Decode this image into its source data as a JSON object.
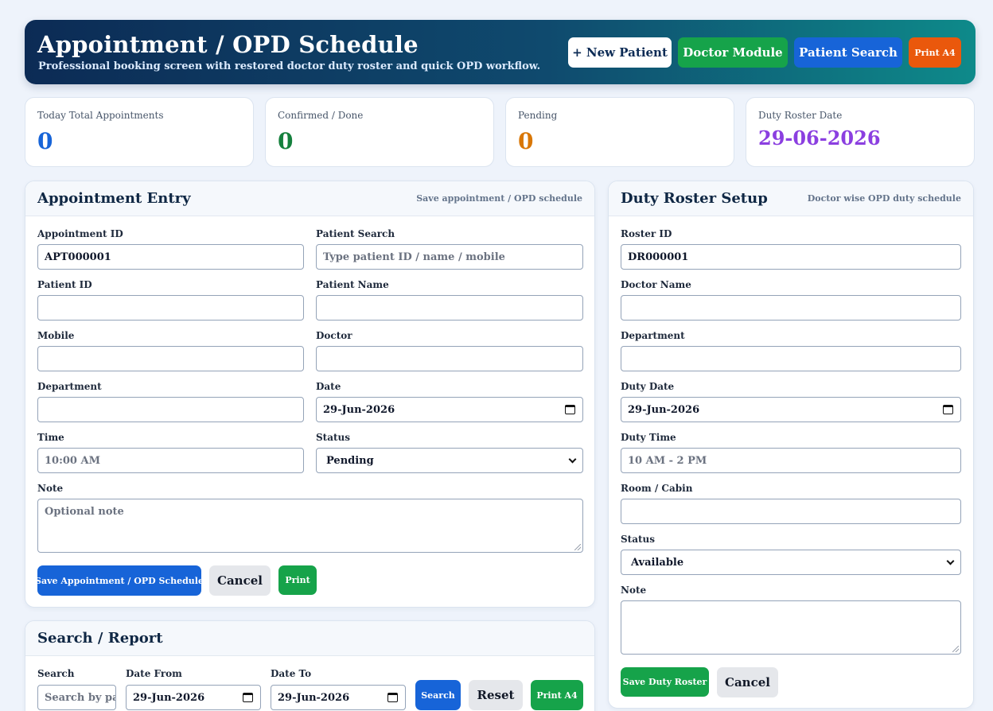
{
  "header": {
    "title": "Appointment / OPD Schedule",
    "subtitle": "Professional booking screen with restored doctor duty roster and quick OPD workflow.",
    "buttons": {
      "new_patient": "+ New Patient",
      "doctor_module": "Doctor Module",
      "patient_search": "Patient Search",
      "print_a4": "Print A4"
    }
  },
  "stats": [
    {
      "label": "Today Total Appointments",
      "value": "0",
      "color": "#1764d8"
    },
    {
      "label": "Confirmed / Done",
      "value": "0",
      "color": "#15803d"
    },
    {
      "label": "Pending",
      "value": "0",
      "color": "#d97706"
    },
    {
      "label": "Duty Roster Date",
      "value": "29-06-2026",
      "color": "#8b3fe0"
    }
  ],
  "appointment": {
    "title": "Appointment Entry",
    "note": "Save appointment / OPD schedule",
    "fields": {
      "appointment_id_label": "Appointment ID",
      "appointment_id_value": "APT000001",
      "patient_search_label": "Patient Search",
      "patient_search_placeholder": "Type patient ID / name / mobile",
      "patient_id_label": "Patient ID",
      "patient_name_label": "Patient Name",
      "mobile_label": "Mobile",
      "doctor_label": "Doctor",
      "department_label": "Department",
      "date_label": "Date",
      "date_value": "29-Jun-2026",
      "time_label": "Time",
      "time_placeholder": "10:00 AM",
      "status_label": "Status",
      "status_value": "Pending",
      "note_label": "Note",
      "note_placeholder": "Optional note"
    },
    "buttons": {
      "save": "Save Appointment / OPD Schedule",
      "cancel": "Cancel",
      "print": "Print"
    }
  },
  "roster": {
    "title": "Duty Roster Setup",
    "note": "Doctor wise OPD duty schedule",
    "fields": {
      "roster_id_label": "Roster ID",
      "roster_id_value": "DR000001",
      "doctor_name_label": "Doctor Name",
      "department_label": "Department",
      "duty_date_label": "Duty Date",
      "duty_date_value": "29-Jun-2026",
      "duty_time_label": "Duty Time",
      "duty_time_placeholder": "10 AM - 2 PM",
      "room_label": "Room / Cabin",
      "status_label": "Status",
      "status_value": "Available",
      "note_label": "Note"
    },
    "buttons": {
      "save": "Save Duty Roster",
      "cancel": "Cancel"
    }
  },
  "report": {
    "title": "Search / Report",
    "search_label": "Search",
    "search_placeholder": "Search by patient",
    "date_from_label": "Date From",
    "date_from_value": "29-Jun-2026",
    "date_to_label": "Date To",
    "date_to_value": "29-Jun-2026",
    "buttons": {
      "search": "Search",
      "reset": "Reset",
      "print_a4": "Print A4"
    }
  }
}
